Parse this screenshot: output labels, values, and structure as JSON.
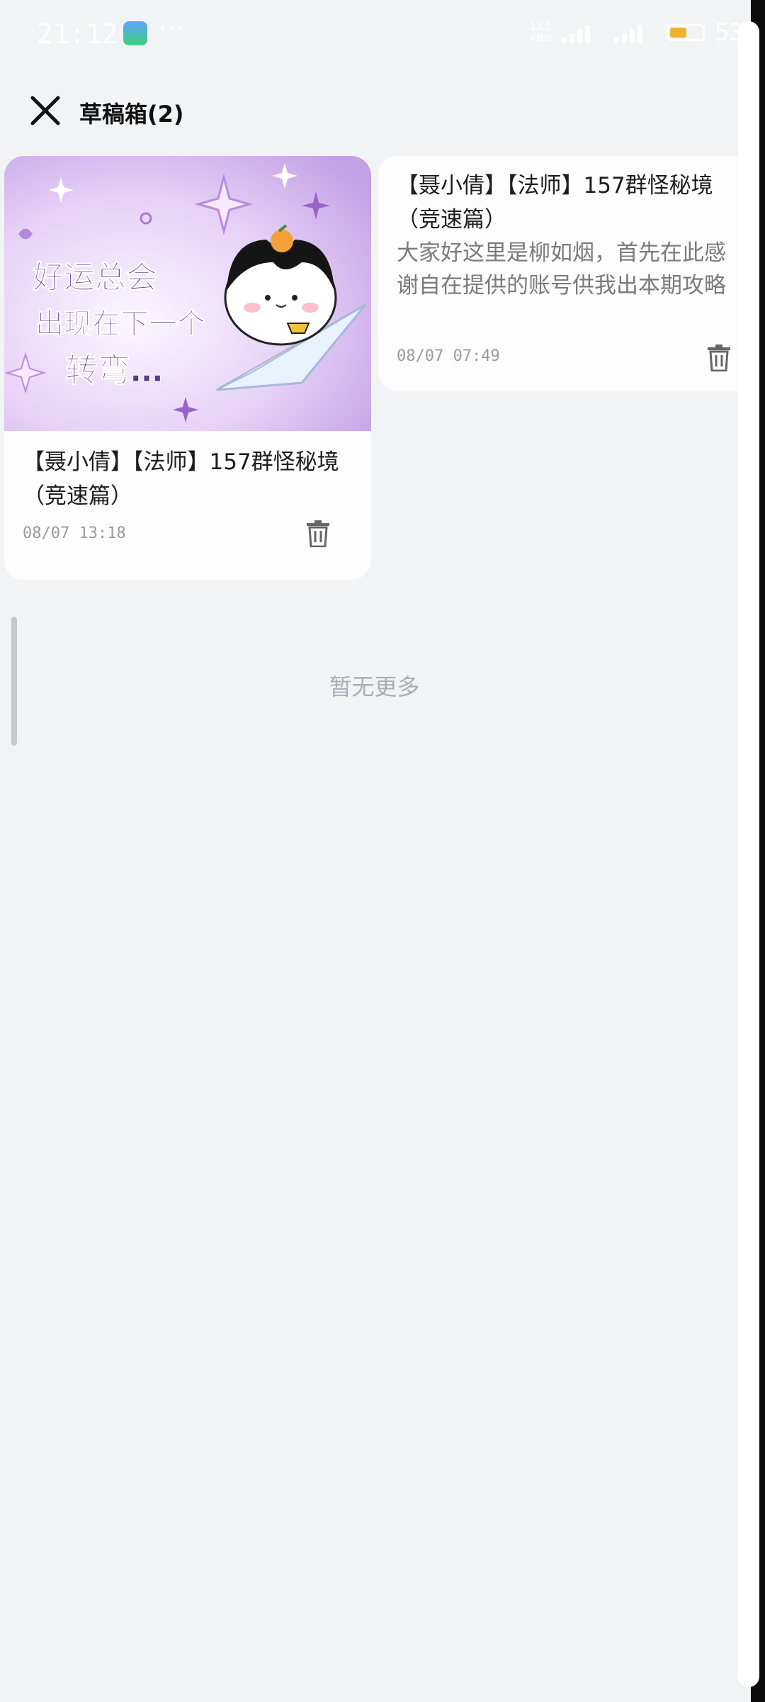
{
  "status_bar": {
    "time": "21:12",
    "more": "···",
    "net_speed_top": "13.5",
    "net_speed_bottom": "KB/s",
    "battery_text": "53",
    "battery_level": 0.53,
    "battery_color": "#f0b030"
  },
  "header": {
    "title": "草稿箱(2)",
    "close_icon": "close-icon"
  },
  "drafts": [
    {
      "title": "【聂小倩】【法师】157群怪秘境（竞速篇）",
      "date": "08/07 13:18",
      "cover_text": [
        "好运总会",
        "出现在下一个",
        "转弯…"
      ],
      "delete_icon": "trash-icon"
    },
    {
      "title": "【聂小倩】【法师】157群怪秘境（竞速篇）",
      "excerpt": "大家好这里是柳如烟，首先在此感谢自在提供的账号供我出本期攻略",
      "date": "08/07 07:49",
      "delete_icon": "trash-icon"
    }
  ],
  "footer": {
    "no_more": "暂无更多"
  },
  "colors": {
    "background": "#f2f3f5",
    "card": "#fdfdfe",
    "muted_text": "#a8adb7"
  }
}
